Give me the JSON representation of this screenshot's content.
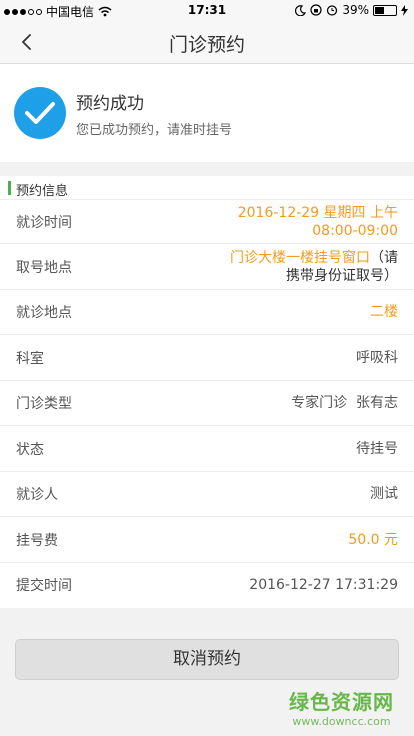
{
  "status_bar": {
    "carrier": "中国电信",
    "time": "17:31",
    "battery": "39%"
  },
  "nav": {
    "title": "门诊预约"
  },
  "success": {
    "title": "预约成功",
    "subtitle": "您已成功预约，请准时挂号"
  },
  "section": {
    "title": "预约信息"
  },
  "rows": {
    "visit_time": {
      "label": "就诊时间",
      "value_line1": "2016-12-29 星期四 上午",
      "value_line2": "08:00-09:00"
    },
    "pickup_place": {
      "label": "取号地点",
      "value_orange": "门诊大楼一楼挂号窗口",
      "value_dark_a": "（请",
      "value_line2": "携带身份证取号）"
    },
    "visit_place": {
      "label": "就诊地点",
      "value": "二楼"
    },
    "department": {
      "label": "科室",
      "value": "呼吸科"
    },
    "clinic_type": {
      "label": "门诊类型",
      "value": "专家门诊  张有志"
    },
    "status": {
      "label": "状态",
      "value": "待挂号"
    },
    "patient": {
      "label": "就诊人",
      "value": "测试"
    },
    "fee": {
      "label": "挂号费",
      "value": "50.0 元"
    },
    "submit_time": {
      "label": "提交时间",
      "value": "2016-12-27 17:31:29"
    }
  },
  "actions": {
    "cancel_label": "取消预约"
  },
  "watermark": {
    "name": "绿色资源网",
    "url": "www.downcc.com"
  },
  "colors": {
    "accent": "#1e9fe8",
    "highlight": "#f29b21",
    "section_bar": "#4caf50"
  }
}
